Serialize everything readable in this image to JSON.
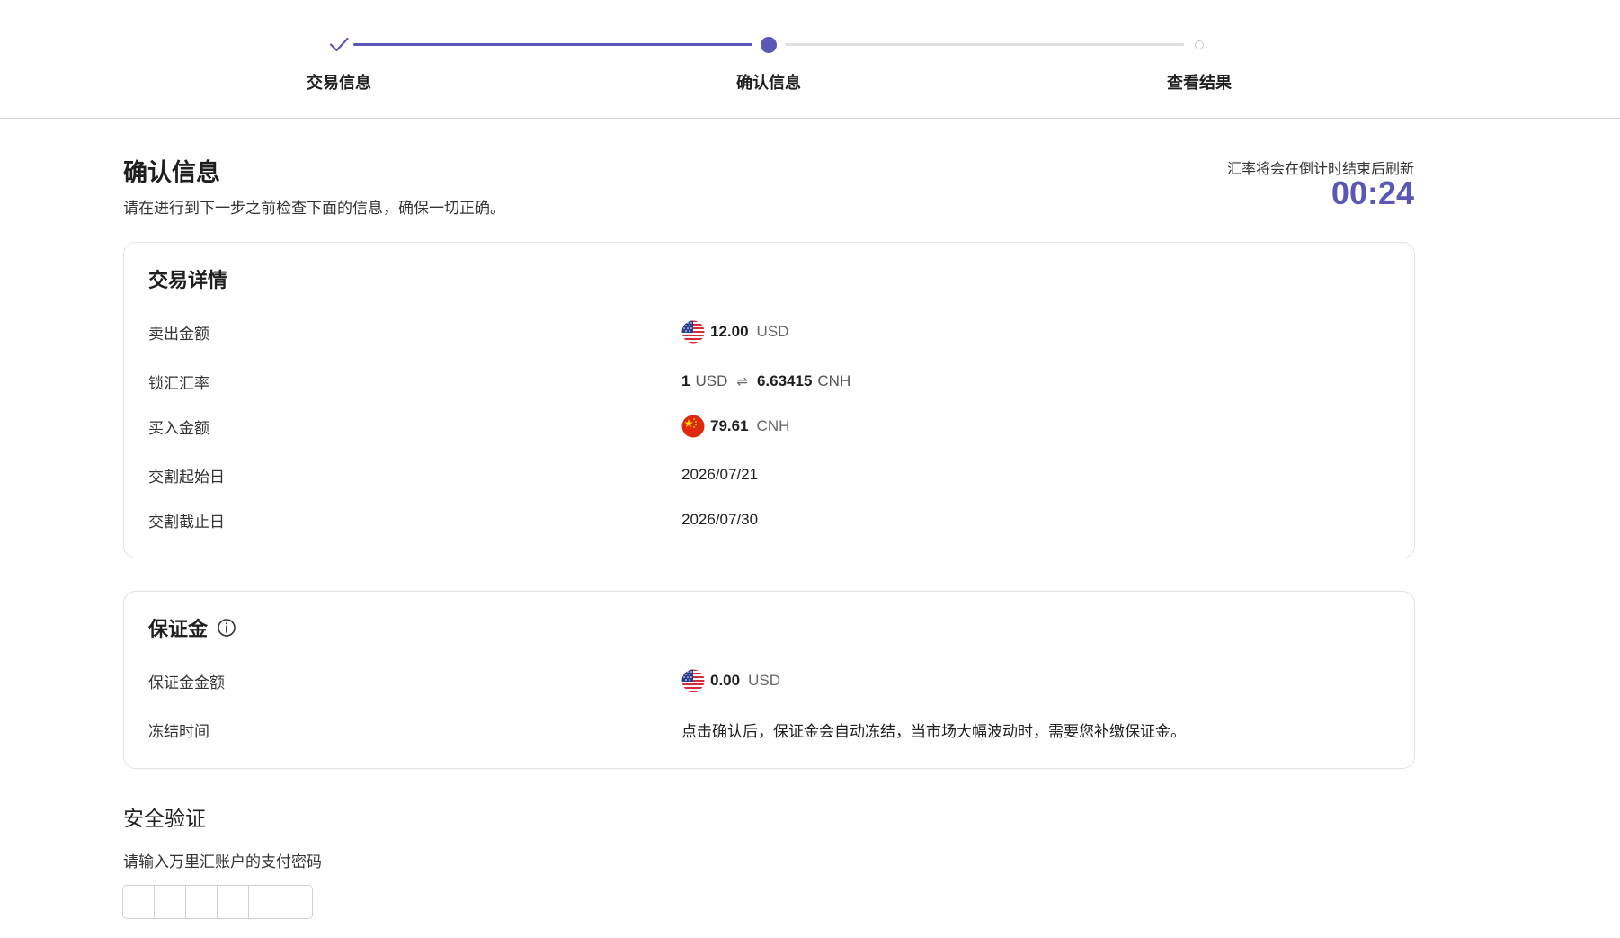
{
  "stepper": {
    "steps": [
      {
        "label": "交易信息",
        "status": "done"
      },
      {
        "label": "确认信息",
        "status": "current"
      },
      {
        "label": "查看结果",
        "status": "pending"
      }
    ]
  },
  "header": {
    "title": "确认信息",
    "subtitle": "请在进行到下一步之前检查下面的信息，确保一切正确。",
    "countdown_label": "汇率将会在倒计时结束后刷新",
    "countdown_value": "00:24"
  },
  "details": {
    "title": "交易详情",
    "sell": {
      "label": "卖出金额",
      "amount": "12.00",
      "currency": "USD",
      "flag": "us-flag-icon"
    },
    "rate": {
      "label": "锁汇汇率",
      "base_num": "1",
      "base_cur": "USD",
      "separator": "⇌",
      "quote_num": "6.63415",
      "quote_cur": "CNH"
    },
    "buy": {
      "label": "买入金额",
      "amount": "79.61",
      "currency": "CNH",
      "flag": "cn-flag-icon"
    },
    "start_date": {
      "label": "交割起始日",
      "value": "2026/07/21"
    },
    "end_date": {
      "label": "交割截止日",
      "value": "2026/07/30"
    }
  },
  "margin": {
    "title": "保证金",
    "amount": {
      "label": "保证金金额",
      "amount": "0.00",
      "currency": "USD",
      "flag": "us-flag-icon"
    },
    "freeze": {
      "label": "冻结时间",
      "value": "点击确认后，保证金会自动冻结，当市场大幅波动时，需要您补缴保证金。"
    }
  },
  "security": {
    "title": "安全验证",
    "description": "请输入万里汇账户的支付密码",
    "pin_length": 6
  },
  "colors": {
    "accent": "#5b58b5",
    "border": "#e3e3e3",
    "muted_line": "#e0e0e0"
  }
}
